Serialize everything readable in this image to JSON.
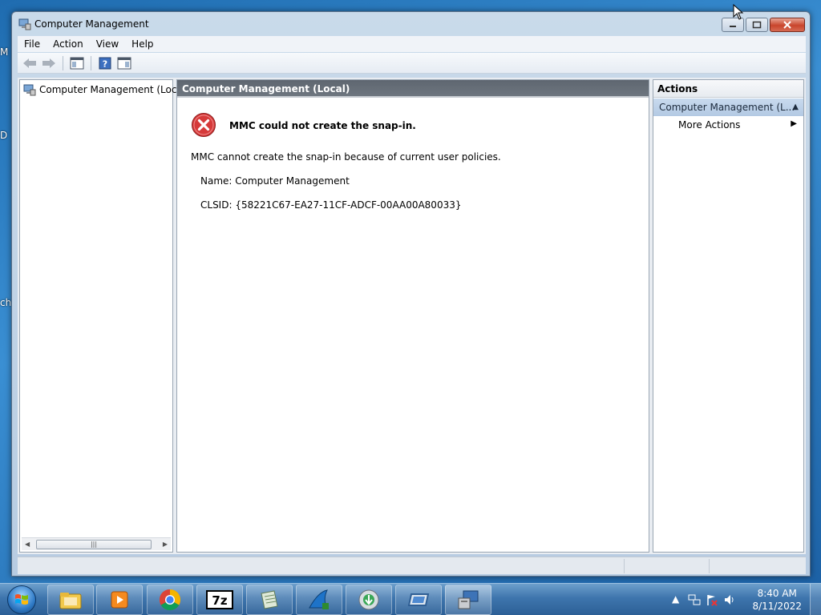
{
  "window": {
    "title": "Computer Management",
    "menu": [
      "File",
      "Action",
      "View",
      "Help"
    ]
  },
  "tree": {
    "root_label": "Computer Management (Local"
  },
  "center": {
    "header": "Computer Management (Local)",
    "error_title": "MMC could not create the snap-in.",
    "error_body": "MMC cannot create the snap-in because of current user policies.",
    "name_line": "Name: Computer Management",
    "clsid_line": "CLSID: {58221C67-EA27-11CF-ADCF-00AA00A80033}"
  },
  "actions": {
    "header": "Actions",
    "group_label": "Computer Management (L...",
    "more_actions": "More Actions"
  },
  "taskbar": {
    "apps": [
      "file-explorer",
      "media-player",
      "chrome",
      "7-zip",
      "notepad",
      "wireshark",
      "installer",
      "remote-desktop",
      "computer-management"
    ],
    "clock_time": "8:40 AM",
    "clock_date": "8/11/2022"
  },
  "desktop": {
    "edge_fragments": [
      "M",
      "D",
      "ch"
    ]
  },
  "colors": {
    "header_bar": "#5e6670",
    "actions_group": "#c9daee",
    "error_red": "#d32f2f"
  }
}
